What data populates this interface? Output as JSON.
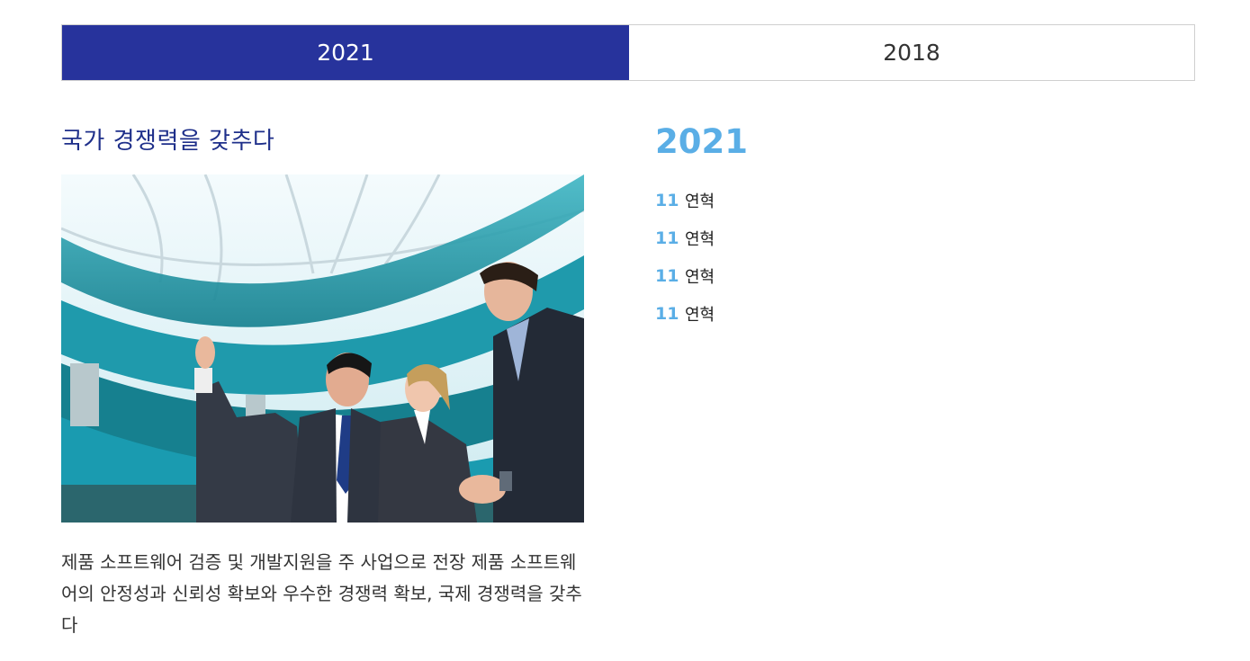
{
  "tabs": [
    {
      "label": "2021",
      "active": true
    },
    {
      "label": "2018",
      "active": false
    }
  ],
  "headline": "국가 경쟁력을 갖추다",
  "photo": {
    "icon": "business-people-looking-up-photo"
  },
  "description": "제품 소프트웨어 검증 및 개발지원을 주 사업으로 전장 제품 소프트웨어의 안정성과 신뢰성 확보와 우수한 경쟁력 확보, 국제 경쟁력을 갖추다",
  "history": {
    "year": "2021",
    "items": [
      {
        "month": "11",
        "text": "연혁"
      },
      {
        "month": "11",
        "text": "연혁"
      },
      {
        "month": "11",
        "text": "연혁"
      },
      {
        "month": "11",
        "text": "연혁"
      }
    ]
  },
  "colors": {
    "accent": "#27339c",
    "headline": "#1e2f8a",
    "year": "#5aaee6"
  }
}
